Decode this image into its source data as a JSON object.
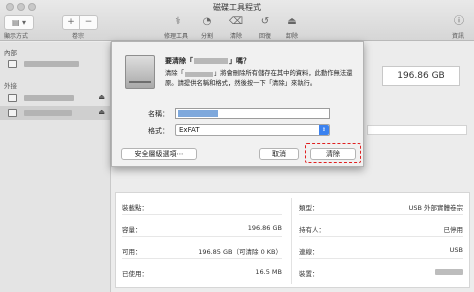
{
  "window": {
    "title": "磁碟工具程式"
  },
  "toolbar": {
    "view_label": "顯示方式",
    "volume_label": "卷宗",
    "add_symbol": "+",
    "remove_symbol": "−",
    "tools": [
      {
        "icon": "stethoscope-icon",
        "glyph": "⚕",
        "label": "修理工具"
      },
      {
        "icon": "partition-icon",
        "glyph": "◔",
        "label": "分割"
      },
      {
        "icon": "erase-icon",
        "glyph": "⌫",
        "label": "清除"
      },
      {
        "icon": "restore-icon",
        "glyph": "↺",
        "label": "回復"
      },
      {
        "icon": "mount-icon",
        "glyph": "⏏",
        "label": "卸除"
      }
    ],
    "info_glyph": "ⓘ",
    "info_label": "資訊"
  },
  "sidebar": {
    "internal_header": "內部",
    "external_header": "外接",
    "eject_glyph": "⏏"
  },
  "capacity_display": "196.86 GB",
  "dialog": {
    "title_prefix": "要清除「",
    "title_suffix": "」嗎？",
    "msg_prefix": "清除「",
    "msg_suffix": "」將會刪除所有儲存在其中的資料，此動作無法還原。請提供名稱和格式，然後按一下「清除」來執行。",
    "name_label": "名稱：",
    "format_label": "格式：",
    "format_value": "ExFAT",
    "format_arrow": "⇕",
    "security_button": "安全層級選項⋯",
    "cancel_button": "取消",
    "erase_button": "清除"
  },
  "info": {
    "left": [
      {
        "label": "裝載點：",
        "value": ""
      },
      {
        "label": "容量：",
        "value": "196.86 GB"
      },
      {
        "label": "可用：",
        "value": "196.85 GB（可清除 0 KB）"
      },
      {
        "label": "已使用：",
        "value": "16.5 MB"
      }
    ],
    "right": [
      {
        "label": "類型：",
        "value": "USB 外部實體卷宗"
      },
      {
        "label": "持有人：",
        "value": "已停用"
      },
      {
        "label": "連線：",
        "value": "USB"
      },
      {
        "label": "裝置：",
        "value": ""
      }
    ]
  },
  "colors": {
    "accent": "#3b82f0",
    "highlight": "#e02020",
    "selection": "#7ea8dc"
  }
}
